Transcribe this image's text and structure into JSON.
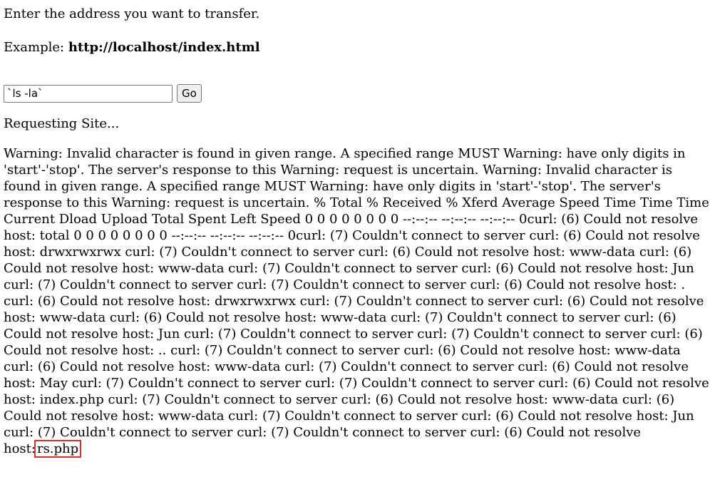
{
  "page": {
    "prompt": "Enter the address you want to transfer.",
    "example_label": "Example: ",
    "example_value": "http://localhost/index.html"
  },
  "form": {
    "address_value": "`ls -la`",
    "go_label": "Go"
  },
  "status": {
    "requesting": "Requesting Site..."
  },
  "output": {
    "text": "Warning: Invalid character is found in given range. A specified range MUST Warning: have only digits in 'start'-'stop'. The server's response to this Warning: request is uncertain. Warning: Invalid character is found in given range. A specified range MUST Warning: have only digits in 'start'-'stop'. The server's response to this Warning: request is uncertain. % Total % Received % Xferd Average Speed Time Time Time Current Dload Upload Total Spent Left Speed 0 0 0 0 0 0 0 0 --:--:-- --:--:-- --:--:-- 0curl: (6) Could not resolve host: total 0 0 0 0 0 0 0 0 --:--:-- --:--:-- --:--:-- 0curl: (7) Couldn't connect to server curl: (6) Could not resolve host: drwxrwxrwx curl: (7) Couldn't connect to server curl: (6) Could not resolve host: www-data curl: (6) Could not resolve host: www-data curl: (7) Couldn't connect to server curl: (6) Could not resolve host: Jun curl: (7) Couldn't connect to server curl: (7) Couldn't connect to server curl: (6) Could not resolve host: . curl: (6) Could not resolve host: drwxrwxrwx curl: (7) Couldn't connect to server curl: (6) Could not resolve host: www-data curl: (6) Could not resolve host: www-data curl: (7) Couldn't connect to server curl: (6) Could not resolve host: Jun curl: (7) Couldn't connect to server curl: (7) Couldn't connect to server curl: (6) Could not resolve host: .. curl: (7) Couldn't connect to server curl: (6) Could not resolve host: www-data curl: (6) Could not resolve host: www-data curl: (7) Couldn't connect to server curl: (6) Could not resolve host: May curl: (7) Couldn't connect to server curl: (7) Couldn't connect to server curl: (6) Could not resolve host: index.php curl: (7) Couldn't connect to server curl: (6) Could not resolve host: www-data curl: (6) Could not resolve host: www-data curl: (7) Couldn't connect to server curl: (6) Could not resolve host: Jun curl: (7) Couldn't connect to server curl: (7) Couldn't connect to server curl: (6) Could not resolve host:",
    "highlighted": "rs.php",
    "highlight_color": "#d32f2f"
  }
}
